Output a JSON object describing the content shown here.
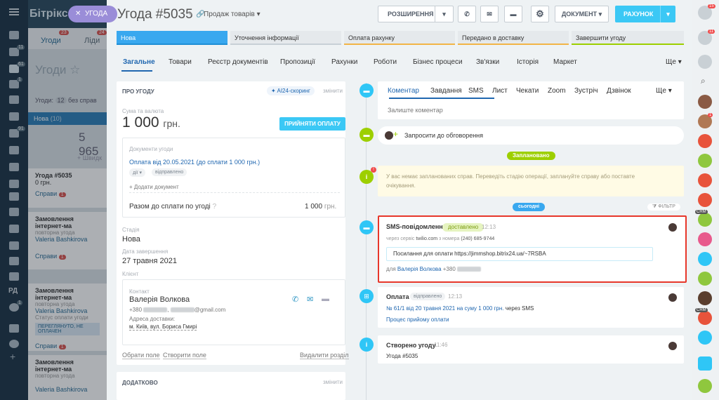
{
  "background": {
    "brand": "Бітрікс",
    "close_pill": "УГОДА",
    "tabs": [
      {
        "label": "Угоди",
        "count": "23"
      },
      {
        "label": "Ліди",
        "count": "24"
      }
    ],
    "header": "Угоди",
    "filter": "Угоди:",
    "filter_count": "12",
    "filter_rest": "без справ",
    "stage": "Нова",
    "stage_count": "(10)",
    "stage_sum": "5 965",
    "add_label": "+ Швидк",
    "cards": [
      {
        "title": "Угода #5035",
        "amount": "0 грн.",
        "tasks": "Справи",
        "tasks_count": "1"
      },
      {
        "title": "Замовлення інтернет-ма",
        "sub": "повторна угода",
        "person": "Valeria Bashkirova",
        "tasks": "Справи",
        "tasks_count": "1"
      },
      {
        "title": "Замовлення інтернет-ма",
        "sub": "повторна угода",
        "person": "Valeria Bashkirova",
        "status_label": "Статус оплати угоди",
        "status_chip": "ПЕРЕГЛЯНУТО, НЕ ОПЛАЧЕН",
        "tasks": "Справи",
        "tasks_count": "1"
      },
      {
        "title": "Замовлення інтернет-ма",
        "sub": "повторна угода",
        "person": "Valeria Bashkirova"
      }
    ]
  },
  "nav": {
    "badges": [
      "11",
      "61",
      "1",
      "91",
      "1"
    ],
    "rd": "РД"
  },
  "header": {
    "title": "Угода #5035",
    "pipeline": "Продаж товарів",
    "btn_expand": "РОЗШИРЕННЯ",
    "btn_document": "ДОКУМЕНТ",
    "btn_invoice": "РАХУНОК"
  },
  "stages": [
    "Нова",
    "Уточнення інформації",
    "Оплата рахунку",
    "Передано в доставку",
    "Завершити угоду"
  ],
  "tabs": [
    "Загальне",
    "Товари",
    "Реєстр документів",
    "Пропозиції",
    "Рахунки",
    "Роботи",
    "Бізнес процеси",
    "Зв'язки",
    "Історія",
    "Маркет",
    "Ще"
  ],
  "about": {
    "heading": "ПРО УГОДУ",
    "ai_scoring": "AI24-скоринг",
    "change": "змінити",
    "sum_label": "Сума та валюта",
    "sum_value": "1 000",
    "currency": "грн.",
    "accept_button": "ПРИЙНЯТИ ОПЛАТУ",
    "docs_label": "Документи угоди",
    "doc_link": "Оплата від 20.05.2021 (до сплати 1 000 грн.)",
    "doc_chip_1": "дії",
    "doc_chip_2": "відправлено",
    "add_doc": "+ Додати документ",
    "to_pay_label": "Разом до сплати по угоді",
    "to_pay_value": "1 000",
    "to_pay_currency": "грн.",
    "stage_label": "Стадія",
    "stage_value": "Нова",
    "close_label": "Дата завершення",
    "close_value": "27 травня 2021",
    "client_label": "Клієнт",
    "contact_label": "Контакт",
    "contact_name": "Валерія Волкова",
    "contact_phone": "+380",
    "contact_email": "@gmail.com",
    "address_label": "Адреса доставки:",
    "address_value": "м. Київ, вул. Бориса Гмирі",
    "choose_field": "Обрати поле",
    "create_field": "Створити поле",
    "delete_section": "Видалити розділ"
  },
  "additional": {
    "heading": "ДОДАТКОВО",
    "change": "змінити"
  },
  "timeline": {
    "composer_tabs": [
      "Коментар",
      "Завдання",
      "SMS",
      "Лист",
      "Чекати",
      "Zoom",
      "Зустріч",
      "Дзвінок",
      "Ще"
    ],
    "composer_placeholder": "Залиште коментар",
    "invite": "Запросити до обговорення",
    "planned": "Заплановано",
    "warning": "У вас немає запланованих справ. Переведіть стадію операції, заплануйте справу або поставте очікування.",
    "today": "сьогодні",
    "filter": "ФІЛЬТР",
    "sms": {
      "title": "SMS-повідомлення",
      "status": "доставлено",
      "time": "12:13",
      "via": "через сервіс",
      "service": "twilio.com",
      "from_label": "з номера",
      "from_number": "(240) 685-9744",
      "message": "Посилання для оплати https://jimmshop.bitrix24.ua/~7RSBA",
      "for_label": "для",
      "for_name": "Валерія Волкова",
      "for_phone": "+380"
    },
    "payment": {
      "title": "Оплата",
      "status": "відправлено",
      "time": "12:13",
      "link": "№ 61/1 від 20 травня 2021 на суму 1 000 грн.",
      "via": "через SMS",
      "process": "Процес прийому оплати"
    },
    "created": {
      "title": "Створено угоду",
      "time": "11:46",
      "body": "Угода #5035"
    }
  },
  "rightbar": {
    "badges": [
      "15",
      "11",
      "1",
      "CRM",
      "CRM"
    ]
  }
}
